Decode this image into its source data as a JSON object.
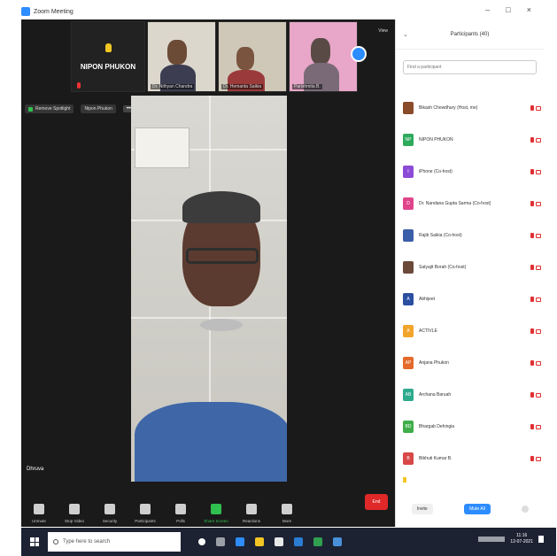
{
  "window": {
    "title": "Zoom Meeting",
    "minimize": "–",
    "maximize": "□",
    "close": "×"
  },
  "thumbs": {
    "first_big_name": "NIPON PHUKON",
    "names": [
      "Dr. Nithyan Chandra",
      "Dr. Hemanta Saikia",
      "Parishmita B."
    ],
    "view_label": "View"
  },
  "spotlight": {
    "remove_spotlight": "Remove Spotlight",
    "second_label": "Nipon Phukon",
    "more": "•••"
  },
  "main_video": {
    "name": "Dhruva"
  },
  "toolbar": {
    "items": [
      "Unmute",
      "Stop Video",
      "Security",
      "Participants",
      "Polls",
      "Share Screen",
      "Reactions",
      "More"
    ],
    "end": "End"
  },
  "panel": {
    "title": "Participants (40)",
    "search_placeholder": "Find a participant",
    "participants": [
      {
        "name": "Bikash Chowdhury (Host, me)",
        "avatar_color": "#8a4b2a",
        "initial": ""
      },
      {
        "name": "NIPON PHUKON",
        "avatar_color": "#2eaa5c",
        "initial": "NP"
      },
      {
        "name": "iPhone (Co-host)",
        "avatar_color": "#8c4bd6",
        "initial": "I"
      },
      {
        "name": "Dr. Nandana Gupta Sarma (Co-host)",
        "avatar_color": "#e0458c",
        "initial": "D"
      },
      {
        "name": "Rajib Saikia (Co-host)",
        "avatar_color": "#3b5ea8",
        "initial": ""
      },
      {
        "name": "Satyajit Borah (Co-host)",
        "avatar_color": "#6b4a3a",
        "initial": ""
      },
      {
        "name": "Abhijeet",
        "avatar_color": "#2b4fa0",
        "initial": "A"
      },
      {
        "name": "ACTIVLE",
        "avatar_color": "#f2a52b",
        "initial": "A"
      },
      {
        "name": "Anjana Phukon",
        "avatar_color": "#e36a2a",
        "initial": "AP"
      },
      {
        "name": "Archana Baruah",
        "avatar_color": "#2eaa8c",
        "initial": "AB"
      },
      {
        "name": "Bhargab Dehingia",
        "avatar_color": "#3fae4a",
        "initial": "BD"
      },
      {
        "name": "Bibhuti Kumar B.",
        "avatar_color": "#d84848",
        "initial": "B"
      }
    ],
    "invite": "Invite",
    "mute_all": "Mute All"
  },
  "taskbar": {
    "search_placeholder": "Type here to search",
    "time": "11:16",
    "date": "12-07-2021"
  }
}
